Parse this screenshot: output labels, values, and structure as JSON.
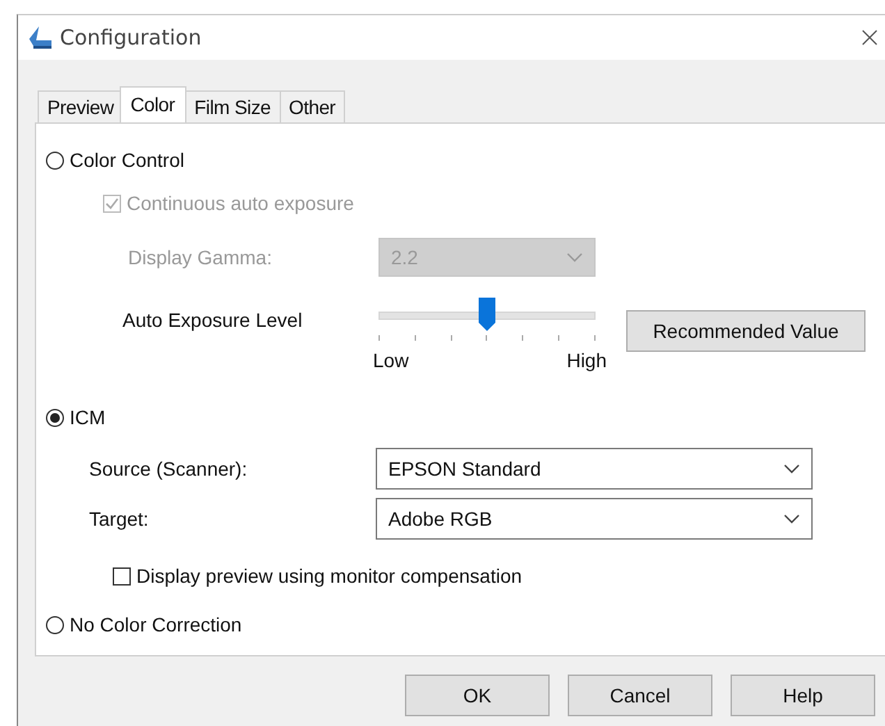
{
  "window": {
    "title": "Configuration"
  },
  "tabs": [
    {
      "label": "Preview",
      "selected": false
    },
    {
      "label": "Color",
      "selected": true
    },
    {
      "label": "Film Size",
      "selected": false
    },
    {
      "label": "Other",
      "selected": false
    }
  ],
  "color_control": {
    "label": "Color Control",
    "selected": false,
    "auto_exposure": {
      "label": "Continuous auto exposure",
      "checked": true,
      "disabled": true
    },
    "gamma": {
      "label": "Display Gamma:",
      "value": "2.2",
      "disabled": true
    },
    "exposure": {
      "label": "Auto Exposure Level",
      "level": 0.5,
      "low": "Low",
      "high": "High",
      "button": "Recommended Value"
    }
  },
  "icm": {
    "label": "ICM",
    "selected": true,
    "source": {
      "label": "Source (Scanner):",
      "value": "EPSON Standard"
    },
    "target": {
      "label": "Target:",
      "value": "Adobe RGB"
    },
    "monitor_compensation": {
      "label": "Display preview using monitor compensation",
      "checked": false
    }
  },
  "no_correction": {
    "label": "No Color Correction",
    "selected": false
  },
  "buttons": [
    "OK",
    "Cancel",
    "Help"
  ]
}
